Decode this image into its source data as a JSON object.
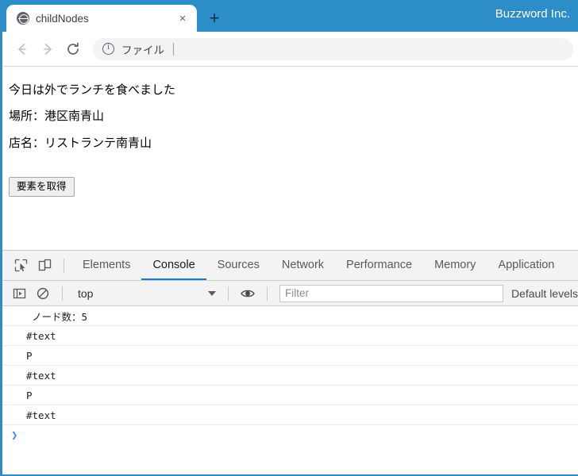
{
  "window": {
    "brand": "Buzzword Inc.",
    "accent_color": "#2d8dc8"
  },
  "tabstrip": {
    "tab_title": "childNodes",
    "favicon": "globe-icon",
    "close_label": "×",
    "newtab_label": "+"
  },
  "toolbar": {
    "back_icon": "arrow-left-icon",
    "forward_icon": "arrow-right-icon",
    "reload_icon": "reload-icon",
    "info_icon": "info-icon",
    "omnibox_text": "ファイル"
  },
  "page": {
    "paragraphs": [
      "今日は外でランチを食べました",
      "場所：港区南青山",
      "店名：リストランテ南青山"
    ],
    "button_label": "要素を取得"
  },
  "devtools": {
    "inspect_icon": "inspect-element-icon",
    "device_icon": "device-toolbar-icon",
    "tabs": [
      {
        "label": "Elements",
        "active": false
      },
      {
        "label": "Console",
        "active": true
      },
      {
        "label": "Sources",
        "active": false
      },
      {
        "label": "Network",
        "active": false
      },
      {
        "label": "Performance",
        "active": false
      },
      {
        "label": "Memory",
        "active": false
      },
      {
        "label": "Application",
        "active": false
      }
    ],
    "console_toolbar": {
      "sidebar_icon": "console-sidebar-icon",
      "clear_icon": "clear-console-icon",
      "context": "top",
      "eye_icon": "live-expression-eye-icon",
      "filter_placeholder": "Filter",
      "filter_value": "",
      "levels_label": "Default levels"
    },
    "console_logs": [
      "ノード数：5",
      "#text",
      "P",
      "#text",
      "P",
      "#text"
    ],
    "prompt_caret": "❯"
  }
}
